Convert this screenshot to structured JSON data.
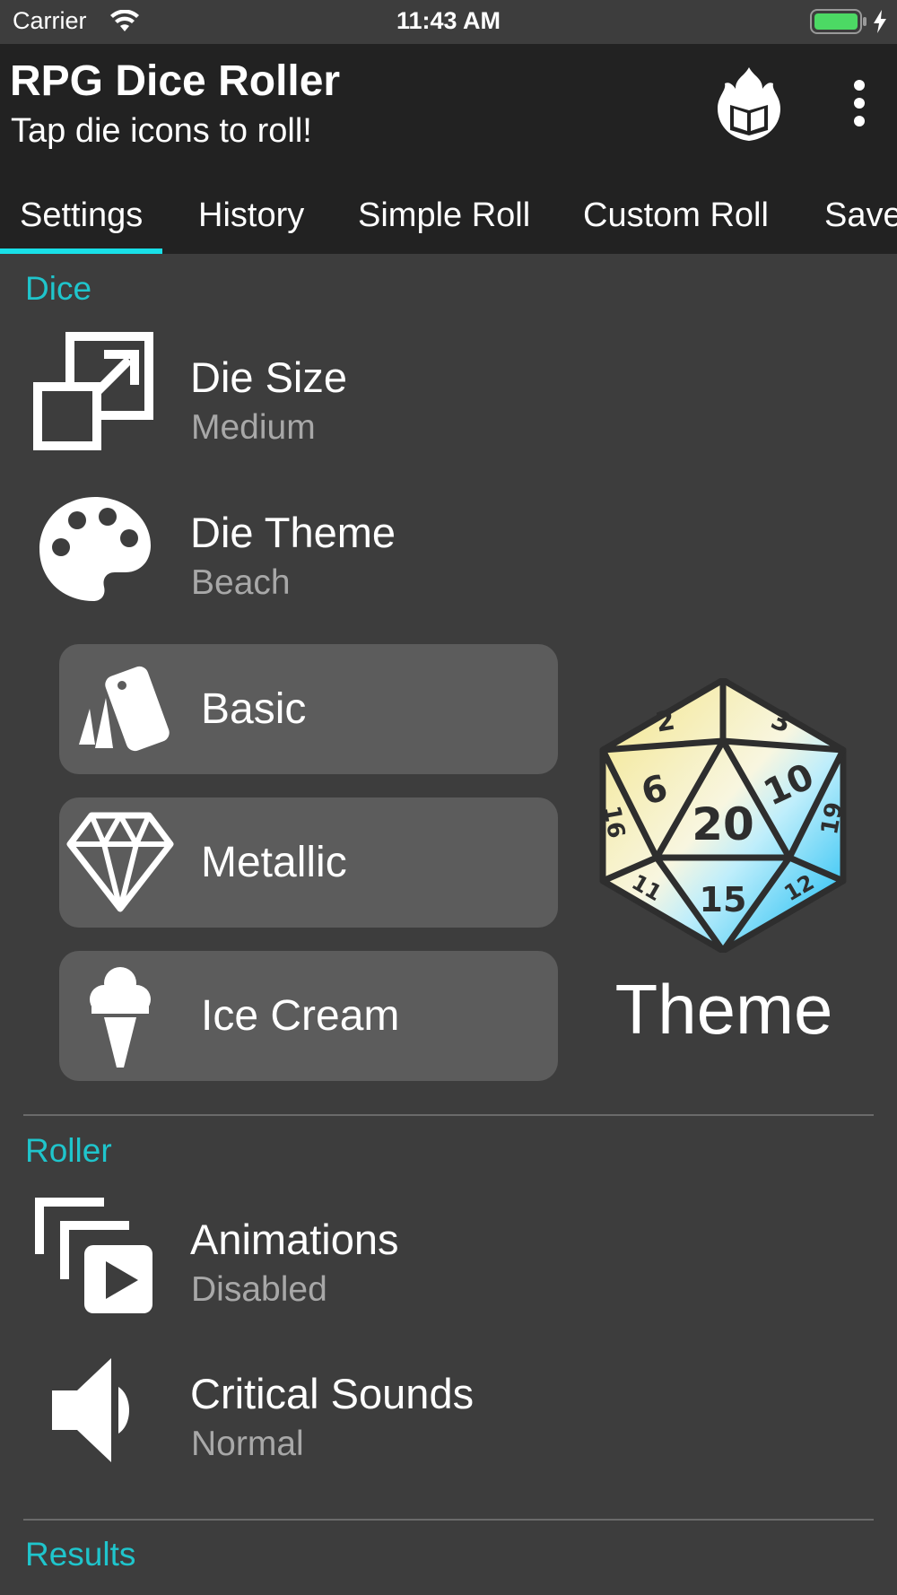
{
  "status_bar": {
    "carrier": "Carrier",
    "time": "11:43 AM"
  },
  "app_bar": {
    "title": "RPG Dice Roller",
    "subtitle": "Tap die icons to roll!",
    "logo_icon": "flaming-book-icon",
    "menu_icon": "more-vertical-icon"
  },
  "tabs": [
    "Settings",
    "History",
    "Simple Roll",
    "Custom Roll",
    "Saved"
  ],
  "active_tab": "Settings",
  "sections": {
    "dice": {
      "header": "Dice",
      "die_size": {
        "title": "Die Size",
        "value": "Medium",
        "icon": "resize-icon"
      },
      "die_theme": {
        "title": "Die Theme",
        "value": "Beach",
        "icon": "palette-icon"
      },
      "theme_buttons": [
        {
          "label": "Basic",
          "icon": "cards-icon"
        },
        {
          "label": "Metallic",
          "icon": "diamond-icon"
        },
        {
          "label": "Ice Cream",
          "icon": "ice-cream-icon"
        }
      ],
      "preview": {
        "caption": "Theme",
        "die_faces": [
          "2",
          "3",
          "6",
          "10",
          "20",
          "16",
          "19",
          "15",
          "11",
          "12"
        ]
      }
    },
    "roller": {
      "header": "Roller",
      "animations": {
        "title": "Animations",
        "value": "Disabled",
        "icon": "animation-icon"
      },
      "critical_sounds": {
        "title": "Critical Sounds",
        "value": "Normal",
        "icon": "speaker-icon"
      }
    },
    "results": {
      "header": "Results"
    }
  },
  "colors": {
    "accent": "#1fc5cc",
    "tab_indicator": "#19e0e8",
    "app_bar": "#222222",
    "background": "#3d3d3d",
    "button": "#5c5c5c",
    "secondary_text": "#a8a8a8"
  }
}
